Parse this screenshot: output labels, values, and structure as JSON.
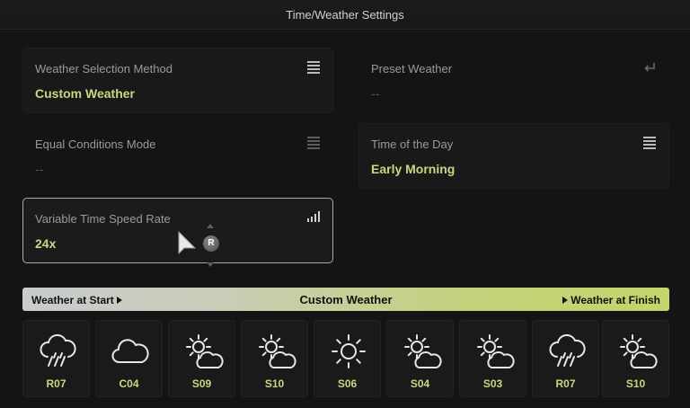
{
  "header": {
    "title": "Time/Weather Settings"
  },
  "panels": {
    "weather_method": {
      "label": "Weather Selection Method",
      "value": "Custom Weather",
      "icon": "menu-icon"
    },
    "preset_weather": {
      "label": "Preset Weather",
      "value": "--",
      "icon": "return-icon"
    },
    "equal_conditions": {
      "label": "Equal Conditions Mode",
      "value": "--",
      "icon": "menu-icon"
    },
    "time_of_day": {
      "label": "Time of the Day",
      "value": "Early Morning",
      "icon": "menu-icon"
    },
    "time_speed": {
      "label": "Variable Time Speed Rate",
      "value": "24x",
      "icon": "signal-bars-icon",
      "badge": "R"
    }
  },
  "weather_bar": {
    "start_label": "Weather at Start",
    "center_label": "Custom Weather",
    "finish_label": "Weather at Finish"
  },
  "weather_slots": [
    {
      "code": "R07",
      "icon": "rain-cloud-icon"
    },
    {
      "code": "C04",
      "icon": "cloud-icon"
    },
    {
      "code": "S09",
      "icon": "sun-cloud-icon"
    },
    {
      "code": "S10",
      "icon": "sun-cloud-icon"
    },
    {
      "code": "S06",
      "icon": "sun-icon"
    },
    {
      "code": "S04",
      "icon": "sun-cloud-icon"
    },
    {
      "code": "S03",
      "icon": "sun-cloud-icon"
    },
    {
      "code": "R07",
      "icon": "rain-cloud-icon"
    },
    {
      "code": "S10",
      "icon": "sun-cloud-icon"
    }
  ],
  "colors": {
    "accent_value": "#c9d77e",
    "background": "#141414",
    "panel": "#191919",
    "bar_start": "#c8cccc",
    "bar_end": "#c5d46c"
  }
}
